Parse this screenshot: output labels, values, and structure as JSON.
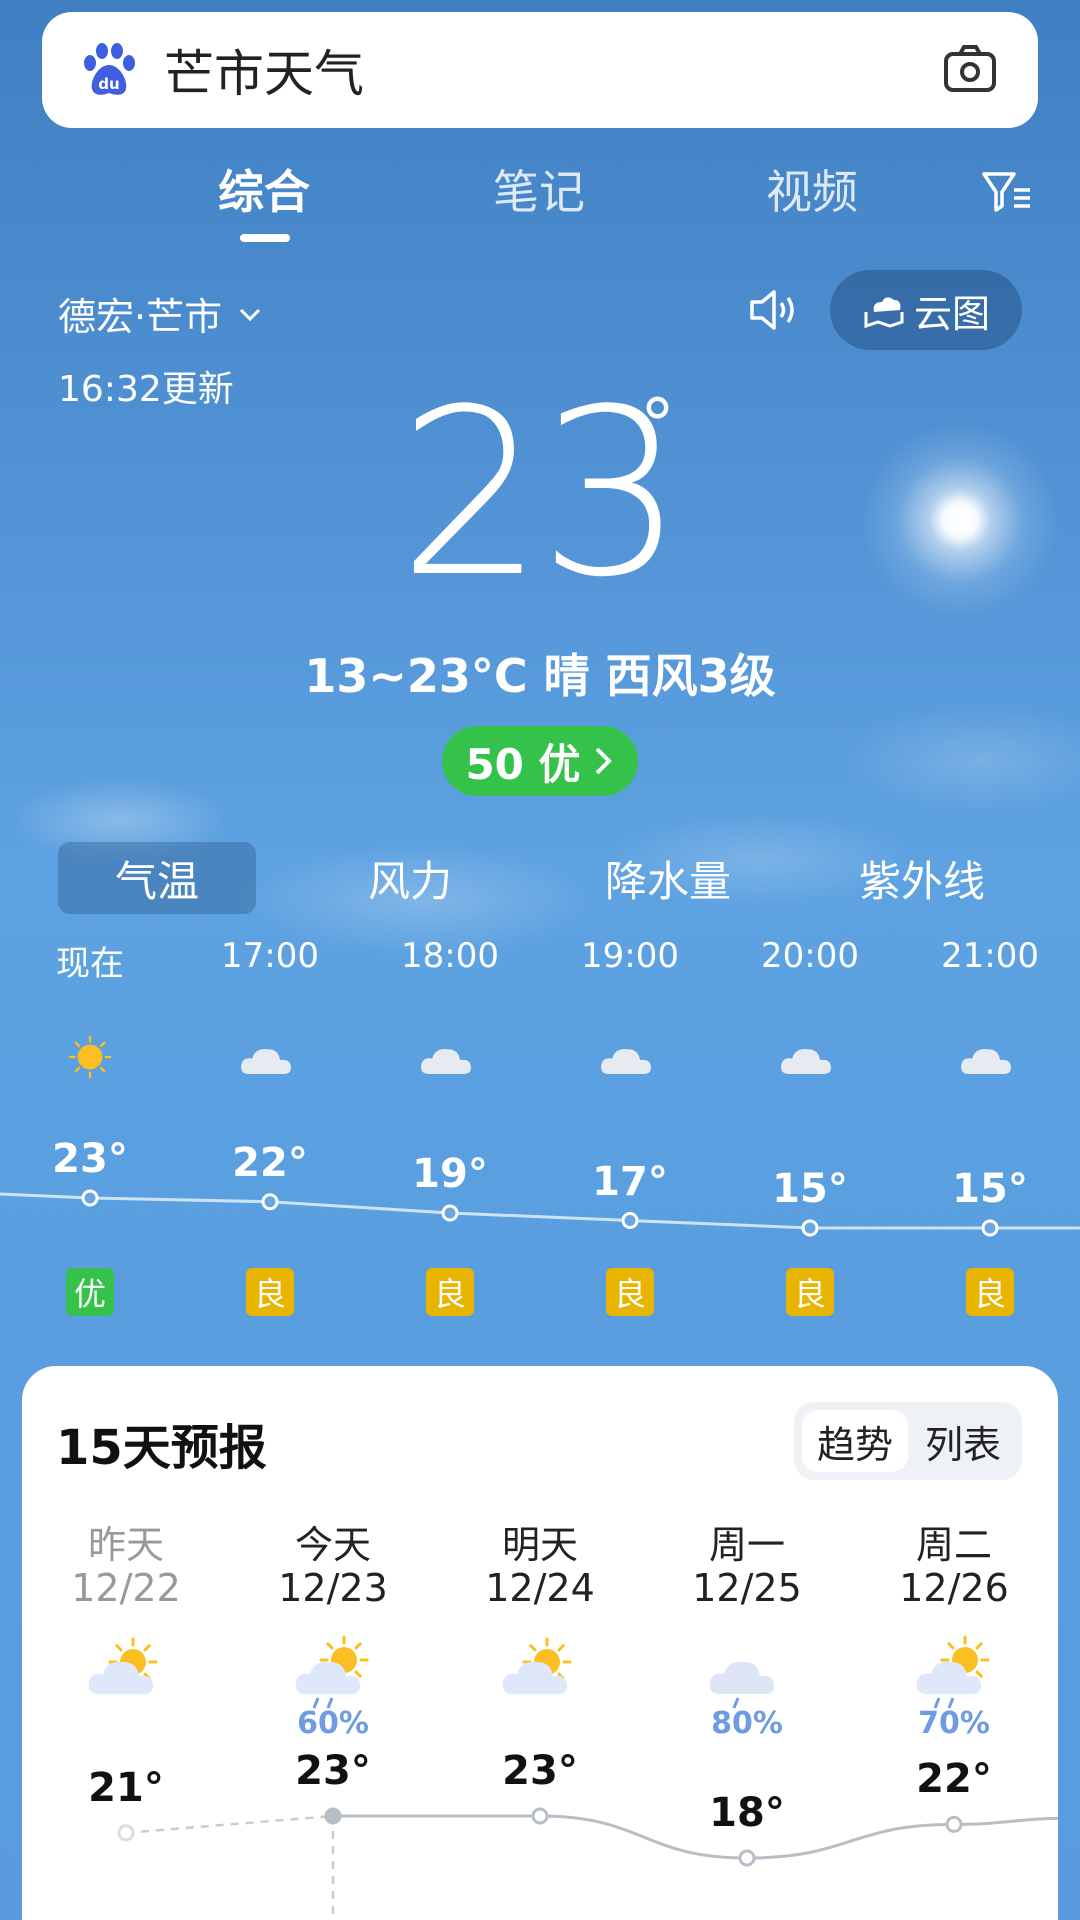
{
  "search": {
    "query": "芒市天气"
  },
  "tabs": [
    "综合",
    "笔记",
    "视频"
  ],
  "location": {
    "name": "德宏·芒市",
    "updated": "16:32更新",
    "cloud_map": "云图"
  },
  "current": {
    "temp": "23",
    "degree": "°",
    "summary": "13~23°C 晴 西风3级",
    "aqi": "50 优",
    "aqi_color": "#35c24a"
  },
  "metric_tabs": [
    "气温",
    "风力",
    "降水量",
    "紫外线"
  ],
  "hourly": [
    {
      "time": "现在",
      "temp": "23°",
      "icon": "sun-icon",
      "quality": "优",
      "quality_color": "#35c24a",
      "value": 23
    },
    {
      "time": "17:00",
      "temp": "22°",
      "icon": "cloud-icon",
      "quality": "良",
      "quality_color": "#e8b400",
      "value": 22
    },
    {
      "time": "18:00",
      "temp": "19°",
      "icon": "cloud-icon",
      "quality": "良",
      "quality_color": "#e8b400",
      "value": 19
    },
    {
      "time": "19:00",
      "temp": "17°",
      "icon": "cloud-icon",
      "quality": "良",
      "quality_color": "#e8b400",
      "value": 17
    },
    {
      "time": "20:00",
      "temp": "15°",
      "icon": "cloud-icon",
      "quality": "良",
      "quality_color": "#e8b400",
      "value": 15
    },
    {
      "time": "21:00",
      "temp": "15°",
      "icon": "cloud-icon",
      "quality": "良",
      "quality_color": "#e8b400",
      "value": 15
    }
  ],
  "forecast": {
    "title": "15天预报",
    "toggle": [
      "趋势",
      "列表"
    ],
    "days": [
      {
        "name": "昨天",
        "date": "12/22",
        "icon": "partly-cloudy-icon",
        "pop": "",
        "high": "21°",
        "high_value": 21
      },
      {
        "name": "今天",
        "date": "12/23",
        "icon": "sun-rain-icon",
        "pop": "60%",
        "high": "23°",
        "high_value": 23
      },
      {
        "name": "明天",
        "date": "12/24",
        "icon": "partly-cloudy-icon",
        "pop": "",
        "high": "23°",
        "high_value": 23
      },
      {
        "name": "周一",
        "date": "12/25",
        "icon": "cloud-rain-icon",
        "pop": "80%",
        "high": "18°",
        "high_value": 18
      },
      {
        "name": "周二",
        "date": "12/26",
        "icon": "sun-rain-icon",
        "pop": "70%",
        "high": "22°",
        "high_value": 22
      }
    ]
  }
}
